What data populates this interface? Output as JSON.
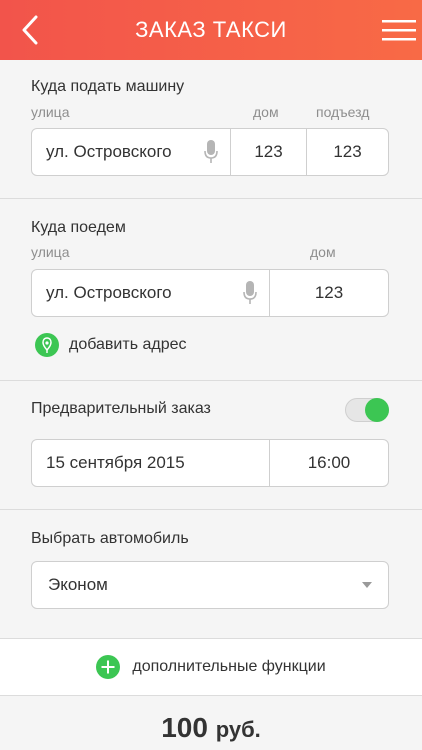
{
  "header": {
    "title": "ЗАКАЗ ТАКСИ"
  },
  "pickup": {
    "title": "Куда подать машину",
    "street_label": "улица",
    "house_label": "дом",
    "entrance_label": "подъезд",
    "street_value": "ул. Островского",
    "house_value": "123",
    "entrance_value": "123"
  },
  "destination": {
    "title": "Куда поедем",
    "street_label": "улица",
    "house_label": "дом",
    "street_value": "ул. Островского",
    "house_value": "123",
    "add_address_label": "добавить адрес"
  },
  "preorder": {
    "title": "Предварительный заказ",
    "enabled": true,
    "date_value": "15 сентября 2015",
    "time_value": "16:00"
  },
  "car": {
    "title": "Выбрать автомобиль",
    "selected": "Эконом"
  },
  "extras": {
    "label": "дополнительные функции"
  },
  "price": {
    "amount": "100",
    "currency": "руб."
  },
  "colors": {
    "header_start": "#f2544b",
    "header_end": "#f86a46",
    "accent_green": "#3cc653"
  }
}
